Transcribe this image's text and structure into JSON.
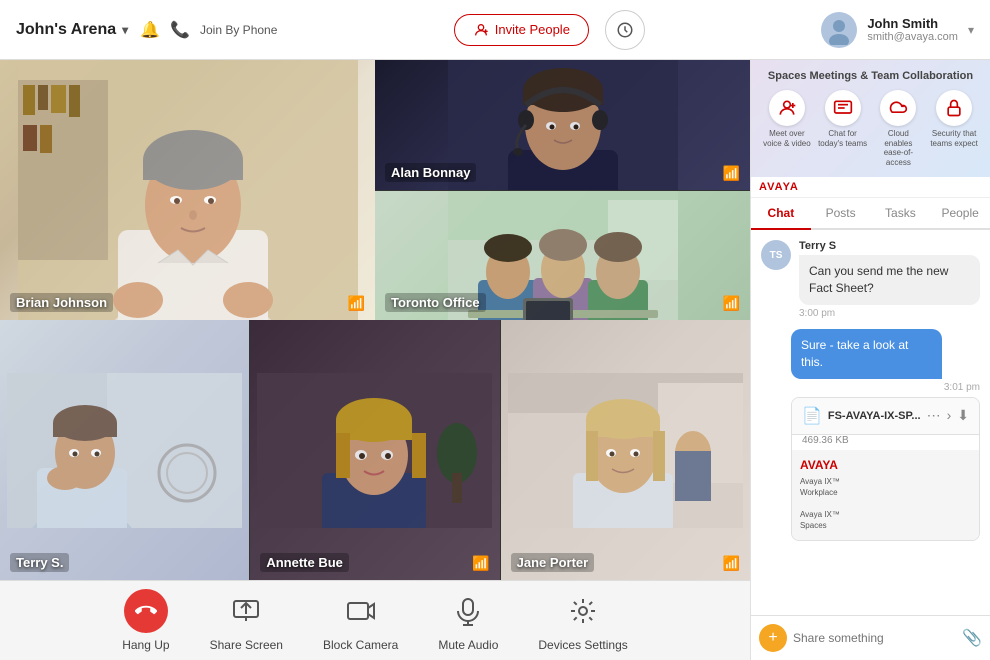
{
  "header": {
    "title": "John's Arena",
    "join_by_phone": "Join By Phone",
    "invite_btn": "Invite People",
    "user_name": "John Smith",
    "user_email": "smith@avaya.com"
  },
  "videos": {
    "brian": {
      "name": "Brian Johnson"
    },
    "alan": {
      "name": "Alan Bonnay"
    },
    "toronto": {
      "name": "Toronto Office"
    },
    "terry_s": {
      "name": "Terry S."
    },
    "annette": {
      "name": "Annette Bue"
    },
    "jane": {
      "name": "Jane Porter"
    }
  },
  "toolbar": {
    "hang_up": "Hang Up",
    "share_screen": "Share Screen",
    "block_camera": "Block Camera",
    "mute_audio": "Mute Audio",
    "devices_settings": "Devices Settings"
  },
  "right_panel": {
    "banner_title": "Spaces Meetings & Team Collaboration",
    "icons": [
      {
        "label": "Meet over voice & video"
      },
      {
        "label": "Chat for today's teams"
      },
      {
        "label": "Cloud enables ease-of-access"
      },
      {
        "label": "Security that teams expect"
      }
    ],
    "tabs": [
      "Chat",
      "Posts",
      "Tasks",
      "People"
    ],
    "active_tab": "Chat",
    "messages": [
      {
        "sender": "Terry S",
        "text": "Can you send me the new Fact Sheet?",
        "time": "3:00 pm",
        "type": "incoming"
      },
      {
        "text": "Sure - take a look at this.",
        "time": "3:01 pm",
        "type": "outgoing"
      }
    ],
    "file": {
      "name": "FS-AVAYA-IX-SP...",
      "size": "469.36 KB",
      "preview_logo": "AVAYA",
      "preview_line1": "Avaya IX™",
      "preview_line2": "Workplace",
      "preview_line3": "Avaya IX™",
      "preview_line4": "Spaces"
    },
    "input_placeholder": "Share something"
  }
}
